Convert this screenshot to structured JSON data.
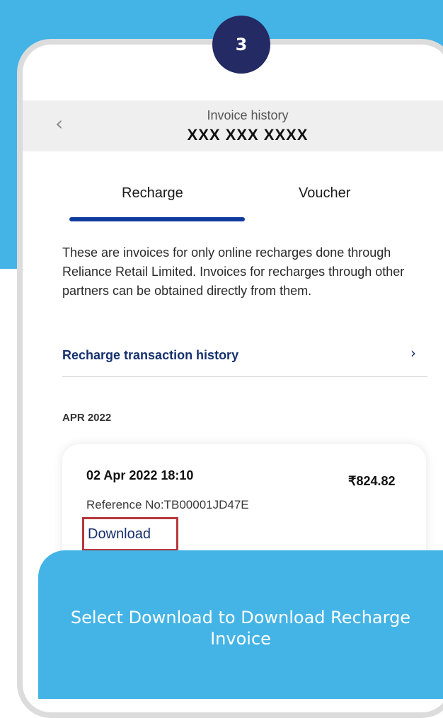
{
  "step": {
    "number": "3"
  },
  "header": {
    "back_icon": "chevron-left-icon",
    "title": "Invoice history",
    "phone_number": "XXX XXX XXXX"
  },
  "tabs": [
    {
      "label": "Recharge",
      "selected": true
    },
    {
      "label": "Voucher",
      "selected": false
    }
  ],
  "info_text": "These are invoices for only online recharges done through Reliance Retail Limited. Invoices for recharges through other partners can be obtained directly from them.",
  "history_link": {
    "label": "Recharge transaction history",
    "icon": "chevron-right-icon"
  },
  "section": {
    "month": "APR 2022"
  },
  "invoice": {
    "date_time": "02 Apr 2022 18:10",
    "amount": "₹824.82",
    "reference": "Reference No:TB00001JD47E",
    "download_label": "Download"
  },
  "instruction": {
    "text": "Select Download to Download Recharge Invoice"
  },
  "colors": {
    "background_accent": "#44b4e6",
    "badge": "#242a64",
    "tab_indicator": "#0f3b9e",
    "link": "#16316e",
    "highlight_border": "#b5383b"
  }
}
